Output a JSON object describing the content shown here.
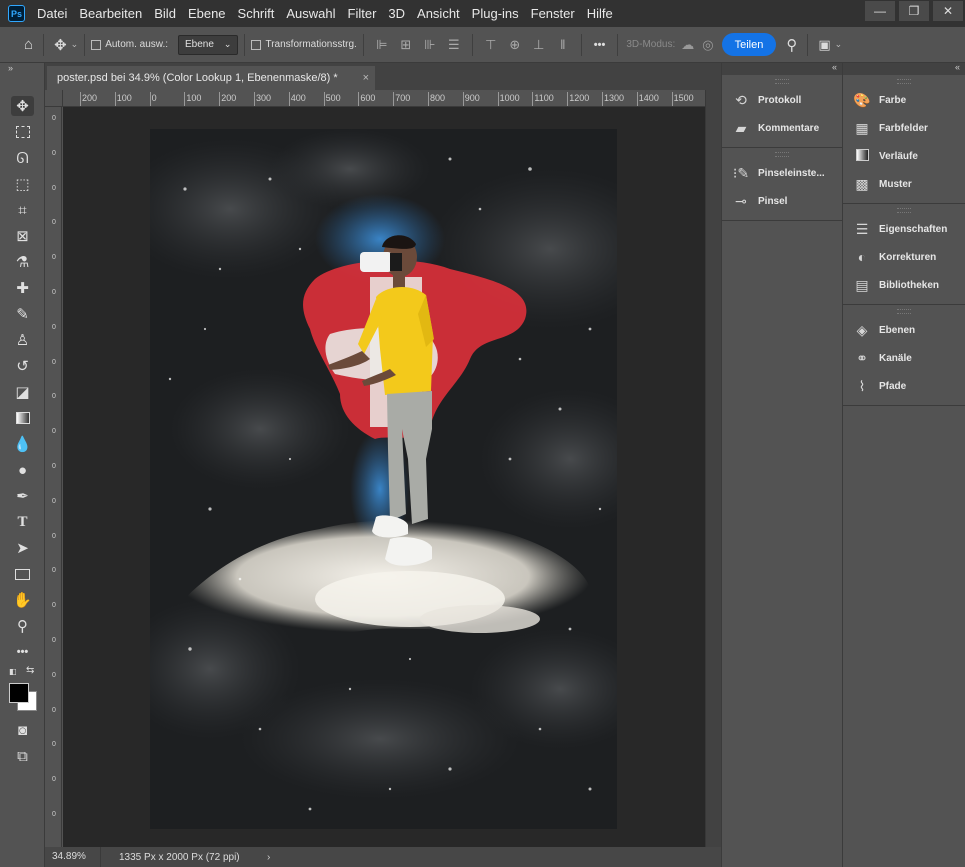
{
  "menubar": {
    "logo": "Ps",
    "items": [
      "Datei",
      "Bearbeiten",
      "Bild",
      "Ebene",
      "Schrift",
      "Auswahl",
      "Filter",
      "3D",
      "Ansicht",
      "Plug-ins",
      "Fenster",
      "Hilfe"
    ],
    "window_controls": [
      "—",
      "❐",
      "✕"
    ]
  },
  "options": {
    "auto_select_label": "Autom. ausw.:",
    "auto_select_value": "Ebene",
    "transform_label": "Transformationsstrg.",
    "more_label": "•••",
    "mode_3d_label": "3D-Modus:",
    "share_label": "Teilen"
  },
  "document": {
    "tab_title": "poster.psd bei 34.9% (Color Lookup 1, Ebenenmaske/8) *",
    "tab_close": "×",
    "ruler_top_labels": [
      "200",
      "100",
      "0",
      "100",
      "200",
      "300",
      "400",
      "500",
      "600",
      "700",
      "800",
      "900",
      "1000",
      "1100",
      "1200",
      "1300",
      "1400",
      "1500"
    ],
    "zoom": "34.89%",
    "doc_info": "1335 Px x 2000 Px (72 ppi)",
    "status_arrow": "›"
  },
  "panels_left": {
    "group1": [
      {
        "label": "Protokoll",
        "icon": "history-icon"
      },
      {
        "label": "Kommentare",
        "icon": "comment-icon"
      }
    ],
    "group2": [
      {
        "label": "Pinseleinste...",
        "icon": "brush-settings-icon"
      },
      {
        "label": "Pinsel",
        "icon": "brush-icon"
      }
    ]
  },
  "panels_right": {
    "group1": [
      {
        "label": "Farbe",
        "icon": "palette-icon"
      },
      {
        "label": "Farbfelder",
        "icon": "swatches-icon"
      },
      {
        "label": "Verläufe",
        "icon": "gradient-icon"
      },
      {
        "label": "Muster",
        "icon": "pattern-icon"
      }
    ],
    "group2": [
      {
        "label": "Eigenschaften",
        "icon": "properties-icon"
      },
      {
        "label": "Korrekturen",
        "icon": "adjustments-icon"
      },
      {
        "label": "Bibliotheken",
        "icon": "libraries-icon"
      }
    ],
    "group3": [
      {
        "label": "Ebenen",
        "icon": "layers-icon"
      },
      {
        "label": "Kanäle",
        "icon": "channels-icon"
      },
      {
        "label": "Pfade",
        "icon": "paths-icon"
      }
    ]
  },
  "colors": {
    "accent": "#1473e6",
    "flag_red": "#e0323a",
    "shirt_yellow": "#f4c81a"
  }
}
